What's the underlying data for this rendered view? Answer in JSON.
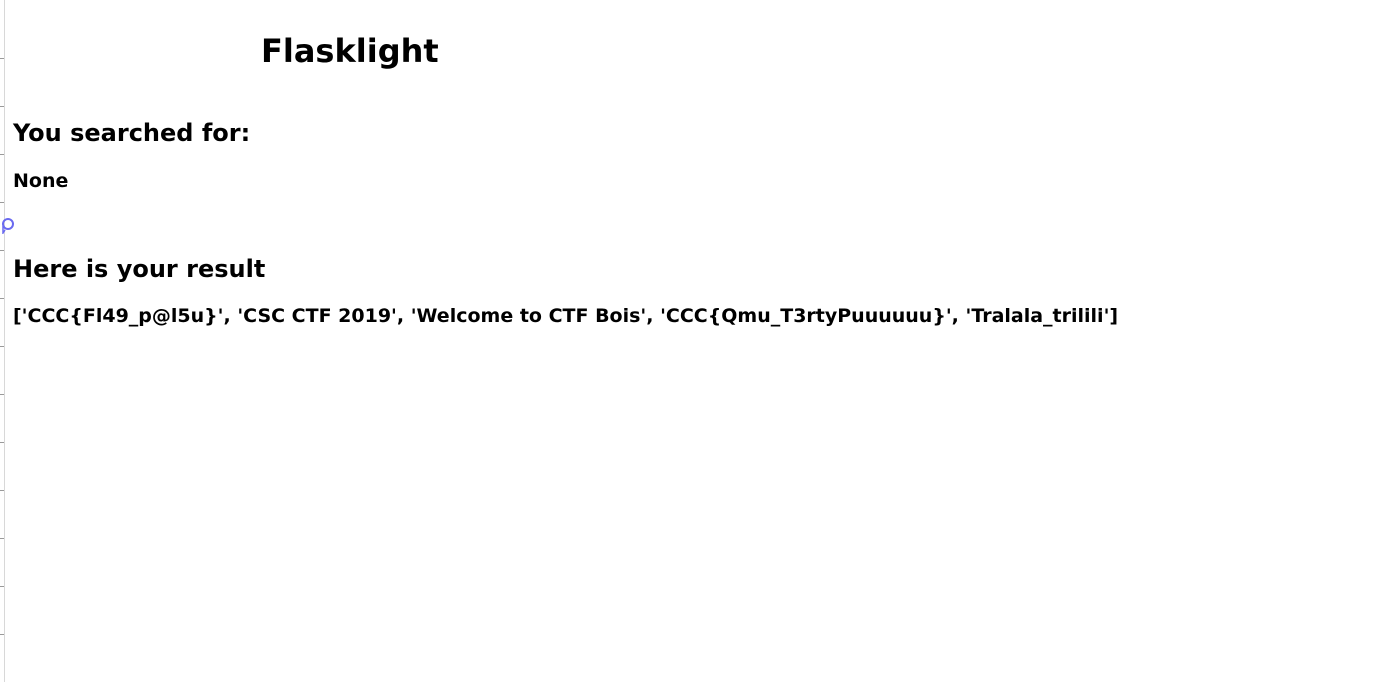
{
  "page": {
    "title": "Flasklight",
    "searched_heading": "You searched for:",
    "search_term": "None",
    "result_heading": "Here is your result",
    "result_list": "['CCC{Fl49_p@l5u}', 'CSC CTF 2019', 'Welcome to CTF Bois', 'CCC{Qmu_T3rtyPuuuuuu}', 'Tralala_trilili']"
  },
  "icons": {
    "cursor": "loading-cursor-icon"
  },
  "colors": {
    "background": "#ffffff",
    "text": "#000000",
    "cursor_accent": "#6a6af0"
  }
}
